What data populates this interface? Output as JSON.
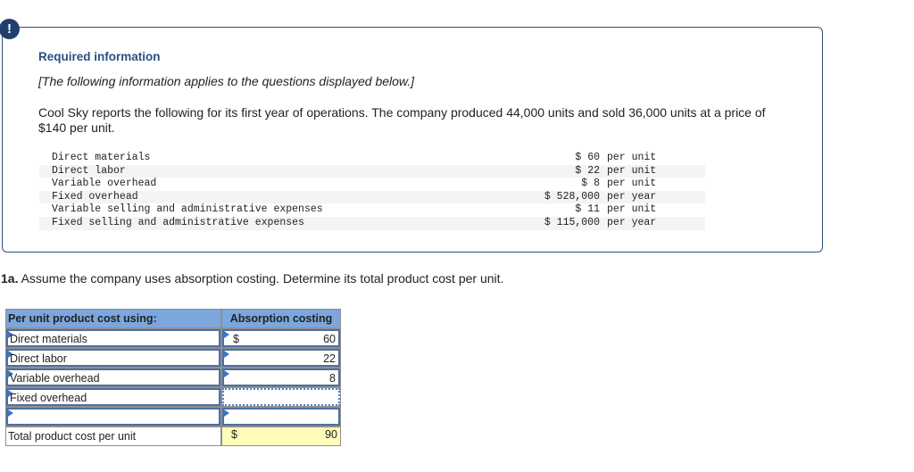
{
  "info": {
    "alert_icon": "!",
    "title": "Required information",
    "subtitle": "[The following information applies to the questions displayed below.]",
    "description": "Cool Sky reports the following for its first year of operations. The company produced 44,000 units and sold 36,000 units at a price of $140 per unit.",
    "items": [
      {
        "label": "Direct materials",
        "amount": "$ 60",
        "unit": "per unit"
      },
      {
        "label": "Direct labor",
        "amount": "$ 22",
        "unit": "per unit"
      },
      {
        "label": "Variable overhead",
        "amount": "$ 8",
        "unit": "per unit"
      },
      {
        "label": "Fixed overhead",
        "amount": "$ 528,000",
        "unit": "per year"
      },
      {
        "label": "Variable selling and administrative expenses",
        "amount": "$ 11",
        "unit": "per unit"
      },
      {
        "label": "Fixed selling and administrative expenses",
        "amount": "$ 115,000",
        "unit": "per year"
      }
    ]
  },
  "question": {
    "number": "1a.",
    "text": " Assume the company uses absorption costing. Determine its total product cost per unit."
  },
  "answer_table": {
    "header_label": "Per unit product cost using:",
    "header_value": "Absorption costing",
    "rows": [
      {
        "label": "Direct materials",
        "currency": "$",
        "value": "60"
      },
      {
        "label": "Direct labor",
        "currency": "",
        "value": "22"
      },
      {
        "label": "Variable overhead",
        "currency": "",
        "value": "8"
      },
      {
        "label": "Fixed overhead",
        "currency": "",
        "value": ""
      },
      {
        "label": "",
        "currency": "",
        "value": ""
      }
    ],
    "total_label": "Total product cost per unit",
    "total_currency": "$",
    "total_value": "90"
  }
}
